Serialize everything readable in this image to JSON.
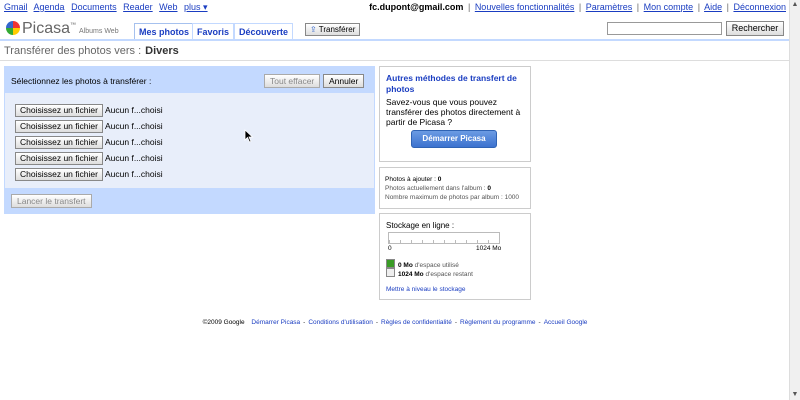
{
  "topnav": {
    "links": [
      "Gmail",
      "Agenda",
      "Documents",
      "Reader",
      "Web",
      "plus ▾"
    ],
    "email": "fc.dupont@gmail.com",
    "right_links": [
      "Nouvelles fonctionnalités",
      "Paramètres",
      "Mon compte",
      "Aide",
      "Déconnexion"
    ]
  },
  "header": {
    "logo_text": "Picasa",
    "logo_tm": "™",
    "logo_sub": "Albums Web",
    "tabs": [
      "Mes photos",
      "Favoris",
      "Découverte"
    ],
    "transfer_button": "Transférer",
    "search_value": "",
    "search_button": "Rechercher"
  },
  "page": {
    "heading": "Transférer des photos vers :",
    "album": "Divers"
  },
  "upload": {
    "select_label": "Sélectionnez les photos à transférer :",
    "clear_button": "Tout effacer",
    "cancel_button": "Annuler",
    "files": [
      {
        "button": "Choisissez un fichier",
        "name": "Aucun f...choisi"
      },
      {
        "button": "Choisissez un fichier",
        "name": "Aucun f...choisi"
      },
      {
        "button": "Choisissez un fichier",
        "name": "Aucun f...choisi"
      },
      {
        "button": "Choisissez un fichier",
        "name": "Aucun f...choisi"
      },
      {
        "button": "Choisissez un fichier",
        "name": "Aucun f...choisi"
      }
    ],
    "start_button": "Lancer le transfert"
  },
  "other_methods": {
    "title": "Autres méthodes de transfert de photos",
    "desc": "Savez-vous que vous pouvez transférer des photos directement à partir de Picasa ?",
    "button": "Démarrer Picasa"
  },
  "counts": {
    "to_add_label": "Photos à ajouter : ",
    "to_add_value": "0",
    "in_album_label": "Photos actuellement dans l'album : ",
    "in_album_value": "0",
    "max_label": "Nombre maximum de photos par album : ",
    "max_value": "1000"
  },
  "storage": {
    "title": "Stockage en ligne :",
    "scale_min": "0",
    "scale_max": "1024 Mo",
    "used_value": "0 Mo",
    "used_text": " d'espace utilisé",
    "free_value": "1024 Mo",
    "free_text": " d'espace restant",
    "upgrade_link": "Mettre à niveau le stockage",
    "used_color": "#3a9c26"
  },
  "footer": {
    "copyright": "©2009 Google",
    "links": [
      "Démarrer Picasa",
      "Conditions d'utilisation",
      "Règles de confidentialité",
      "Règlement du programme",
      "Accueil Google"
    ]
  }
}
